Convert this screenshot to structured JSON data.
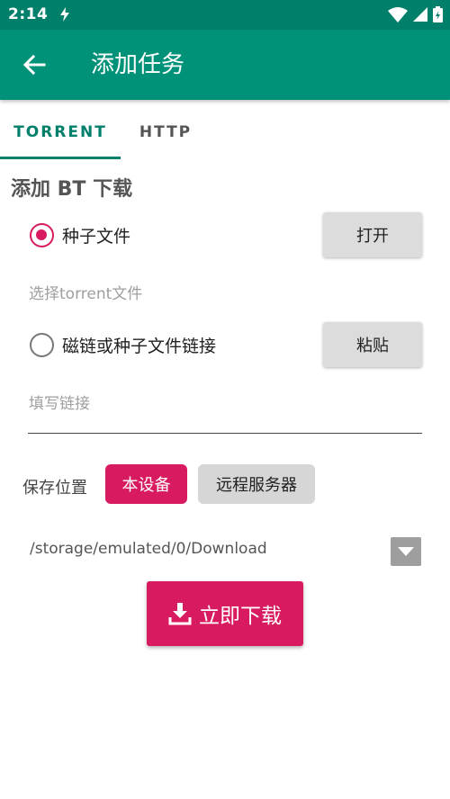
{
  "status_bar": {
    "time": "2:14"
  },
  "app_bar": {
    "title": "添加任务"
  },
  "tabs": [
    {
      "label": "TORRENT",
      "selected": true
    },
    {
      "label": "HTTP",
      "selected": false
    }
  ],
  "form": {
    "section_title": "添加 BT 下载",
    "torrent_option": {
      "label": "种子文件",
      "checked": true,
      "button": "打开",
      "hint": "选择torrent文件"
    },
    "link_option": {
      "label": "磁链或种子文件链接",
      "checked": false,
      "button": "粘贴",
      "placeholder": "填写链接"
    },
    "save_location": {
      "label": "保存位置",
      "options": [
        {
          "label": "本设备",
          "selected": true
        },
        {
          "label": "远程服务器",
          "selected": false
        }
      ],
      "path": "/storage/emulated/0/Download"
    },
    "download_button": "立即下载"
  },
  "colors": {
    "primary_dark": "#00806b",
    "primary": "#009279",
    "accent": "#d81b60"
  }
}
